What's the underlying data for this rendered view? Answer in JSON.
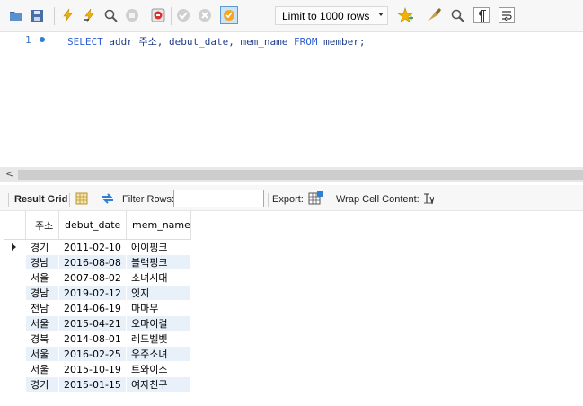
{
  "toolbar": {
    "limit_label": "Limit to 1000 rows"
  },
  "editor": {
    "line_number": "1",
    "sql": {
      "kw_select": "SELECT",
      "rest1": " addr 주소, debut_date, mem_name ",
      "kw_from": "FROM",
      "rest2": " member;"
    }
  },
  "result_toolbar": {
    "result_grid_label": "Result Grid",
    "filter_label": "Filter Rows:",
    "filter_value": "",
    "export_label": "Export:",
    "wrap_label": "Wrap Cell Content:"
  },
  "grid": {
    "columns": [
      "주소",
      "debut_date",
      "mem_name"
    ],
    "rows": [
      [
        "경기",
        "2011-02-10",
        "에이핑크"
      ],
      [
        "경남",
        "2016-08-08",
        "블랙핑크"
      ],
      [
        "서울",
        "2007-08-02",
        "소녀시대"
      ],
      [
        "경남",
        "2019-02-12",
        "잇지"
      ],
      [
        "전남",
        "2014-06-19",
        "마마무"
      ],
      [
        "서울",
        "2015-04-21",
        "오마이걸"
      ],
      [
        "경북",
        "2014-08-01",
        "레드벨벳"
      ],
      [
        "서울",
        "2016-02-25",
        "우주소녀"
      ],
      [
        "서울",
        "2015-10-19",
        "트와이스"
      ],
      [
        "경기",
        "2015-01-15",
        "여자친구"
      ]
    ]
  },
  "icons": {
    "accent": "#2f7ed8",
    "bolt": "#f0b400"
  }
}
